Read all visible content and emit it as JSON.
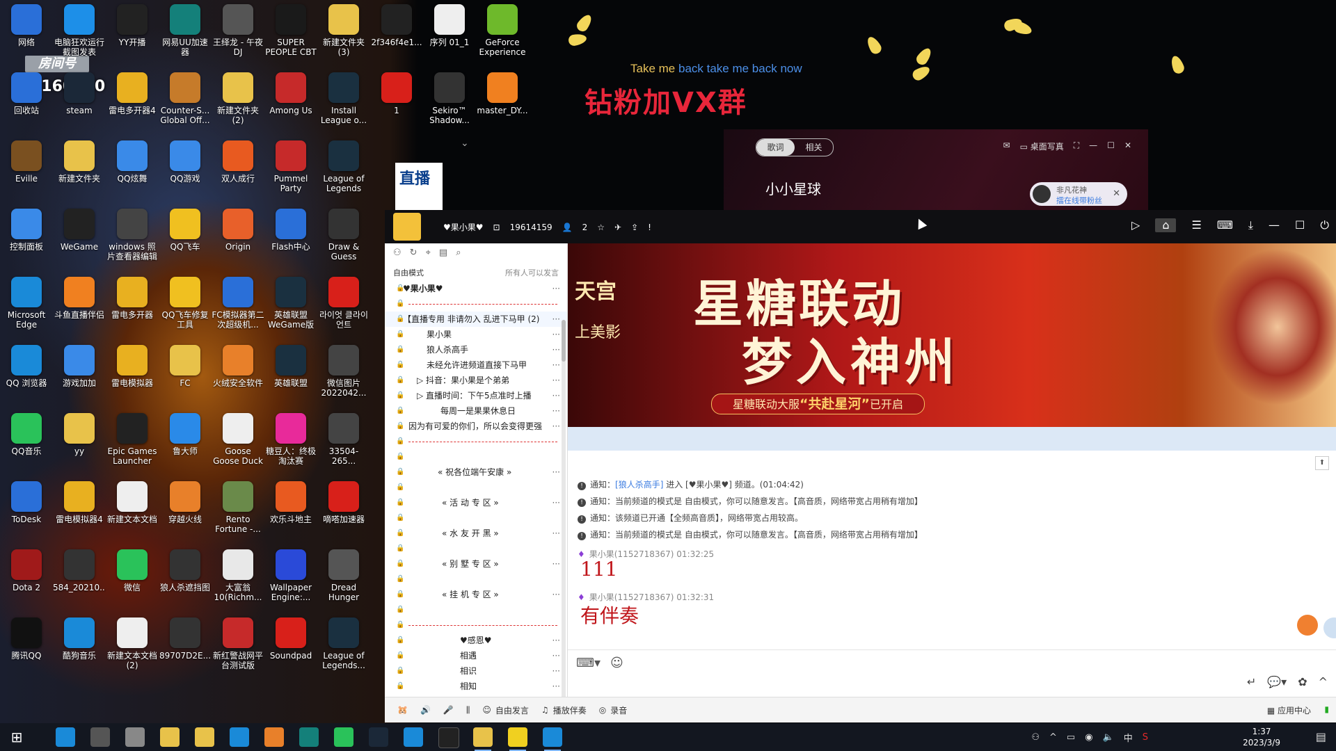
{
  "overlay": {
    "lyric_sung": "Take me ",
    "lyric_unsung": "back take me back now",
    "title": "钻粉加VX群",
    "room_label": "房间号",
    "room_number": "3160250"
  },
  "desktop_icons": [
    {
      "label": "网络",
      "icon": "network-icon",
      "color": "#2a6fd8"
    },
    {
      "label": "电脑狂欢运行截图发表",
      "icon": "win-icon",
      "color": "#1d8fe8"
    },
    {
      "label": "YY开播",
      "icon": "yy-live-icon",
      "color": "#222"
    },
    {
      "label": "网易UU加速器",
      "icon": "uu-icon",
      "color": "#14807a"
    },
    {
      "label": "王绎龙 - 午夜DJ",
      "icon": "media-thumb-icon",
      "color": "#555"
    },
    {
      "label": "SUPER PEOPLE CBT",
      "icon": "super-people-icon",
      "color": "#1a1a1a"
    },
    {
      "label": "新建文件夹 (3)",
      "icon": "folder-icon",
      "color": "#e8c24a"
    },
    {
      "label": "2f346f4e1...",
      "icon": "file-icon",
      "color": "#222"
    },
    {
      "label": "序列 01_1",
      "icon": "video-file-icon",
      "color": "#eee"
    },
    {
      "label": "GeForce Experience",
      "icon": "nvidia-icon",
      "color": "#6eb92b"
    },
    {
      "label": "回收站",
      "icon": "recycle-bin-icon",
      "color": "#2a6fd8"
    },
    {
      "label": "steam",
      "icon": "steam-icon",
      "color": "#1b2838"
    },
    {
      "label": "雷电多开器4",
      "icon": "ld-multi-icon",
      "color": "#e8b020"
    },
    {
      "label": "Counter-S... Global Off...",
      "icon": "csgo-icon",
      "color": "#c67b2a"
    },
    {
      "label": "新建文件夹 (2)",
      "icon": "folder-icon",
      "color": "#e8c24a"
    },
    {
      "label": "Among Us",
      "icon": "among-us-icon",
      "color": "#c62a2a"
    },
    {
      "label": "Install League o...",
      "icon": "lol-icon",
      "color": "#1a3040"
    },
    {
      "label": "1",
      "icon": "flag-icon",
      "color": "#d8201a"
    },
    {
      "label": "Sekiro™ Shadow...",
      "icon": "sekiro-icon",
      "color": "#333"
    },
    {
      "label": "master_DY...",
      "icon": "douyu-icon",
      "color": "#f08020"
    },
    {
      "label": "Eville",
      "icon": "eville-icon",
      "color": "#7a5020"
    },
    {
      "label": "新建文件夹",
      "icon": "folder-icon",
      "color": "#e8c24a"
    },
    {
      "label": "QQ炫舞",
      "icon": "qq-dance-icon",
      "color": "#3a8ae8"
    },
    {
      "label": "QQ游戏",
      "icon": "qq-game-icon",
      "color": "#3a8ae8"
    },
    {
      "label": "双人成行",
      "icon": "it-takes-two-icon",
      "color": "#e85a20"
    },
    {
      "label": "Pummel Party",
      "icon": "pummel-party-icon",
      "color": "#c62a2a"
    },
    {
      "label": "League of Legends",
      "icon": "lol-icon",
      "color": "#1a3040"
    },
    {
      "label": "控制面板",
      "icon": "control-panel-icon",
      "color": "#3a8ae8"
    },
    {
      "label": "WeGame",
      "icon": "wegame-icon",
      "color": "#222"
    },
    {
      "label": "windows 照片查看器编辑",
      "icon": "photo-viewer-icon",
      "color": "#444"
    },
    {
      "label": "QQ飞车",
      "icon": "qq-speed-icon",
      "color": "#f0c020"
    },
    {
      "label": "Origin",
      "icon": "origin-icon",
      "color": "#e8602a"
    },
    {
      "label": "Flash中心",
      "icon": "flash-icon",
      "color": "#2a6fd8"
    },
    {
      "label": "Draw & Guess",
      "icon": "draw-guess-icon",
      "color": "#333"
    },
    {
      "label": "Microsoft Edge",
      "icon": "edge-icon",
      "color": "#1a8ad8"
    },
    {
      "label": "斗鱼直播伴侣",
      "icon": "douyu-companion-icon",
      "color": "#f08020"
    },
    {
      "label": "雷电多开器",
      "icon": "ld-multi-icon",
      "color": "#e8b020"
    },
    {
      "label": "QQ飞车修复工具",
      "icon": "qq-speed-icon",
      "color": "#f0c020"
    },
    {
      "label": "FC模拟器第二次超级机...",
      "icon": "fc-emulator-icon",
      "color": "#2a6fd8"
    },
    {
      "label": "英雄联盟WeGame版",
      "icon": "lol-icon",
      "color": "#1a3040"
    },
    {
      "label": "라이엇 클라이언트",
      "icon": "riot-icon",
      "color": "#d8201a"
    },
    {
      "label": "QQ 浏览器",
      "icon": "qq-browser-icon",
      "color": "#1a8ad8"
    },
    {
      "label": "游戏加加",
      "icon": "game-plus-icon",
      "color": "#3a8ae8"
    },
    {
      "label": "雷电模拟器",
      "icon": "ld-player-icon",
      "color": "#e8b020"
    },
    {
      "label": "FC",
      "icon": "folder-icon",
      "color": "#e8c24a"
    },
    {
      "label": "火绒安全软件",
      "icon": "huorong-icon",
      "color": "#e8802a"
    },
    {
      "label": "英雄联盟",
      "icon": "lol-icon",
      "color": "#1a3040"
    },
    {
      "label": "微信图片 2022042...",
      "icon": "image-file-icon",
      "color": "#444"
    },
    {
      "label": "QQ音乐",
      "icon": "qq-music-icon",
      "color": "#2ac25a"
    },
    {
      "label": "yy",
      "icon": "yy-icon",
      "color": "#e8c24a"
    },
    {
      "label": "Epic Games Launcher",
      "icon": "epic-icon",
      "color": "#222"
    },
    {
      "label": "鲁大师",
      "icon": "ludashi-icon",
      "color": "#2a8ae8"
    },
    {
      "label": "Goose Goose Duck",
      "icon": "goose-icon",
      "color": "#eee"
    },
    {
      "label": "糖豆人：终极淘汰赛",
      "icon": "fall-guys-icon",
      "color": "#e82a9a"
    },
    {
      "label": "33504-265...",
      "icon": "image-file-icon",
      "color": "#444"
    },
    {
      "label": "ToDesk",
      "icon": "todesk-icon",
      "color": "#2a6fd8"
    },
    {
      "label": "雷电模拟器4",
      "icon": "ld-player-icon",
      "color": "#e8b020"
    },
    {
      "label": "新建文本文档",
      "icon": "text-file-icon",
      "color": "#eee"
    },
    {
      "label": "穿越火线",
      "icon": "crossfire-icon",
      "color": "#e8802a"
    },
    {
      "label": "Rento Fortune -...",
      "icon": "rento-icon",
      "color": "#6a8a4a"
    },
    {
      "label": "欢乐斗地主",
      "icon": "doudizhu-icon",
      "color": "#e85a20"
    },
    {
      "label": "嘀嗒加速器",
      "icon": "dida-icon",
      "color": "#d8201a"
    },
    {
      "label": "Dota 2",
      "icon": "dota2-icon",
      "color": "#a01a1a"
    },
    {
      "label": "584_20210...",
      "icon": "video-file-icon",
      "color": "#333"
    },
    {
      "label": "微信",
      "icon": "wechat-icon",
      "color": "#2ac25a"
    },
    {
      "label": "狼人杀遮挡图",
      "icon": "image-file-icon",
      "color": "#333"
    },
    {
      "label": "大富翁10(Richm...",
      "icon": "richman-icon",
      "color": "#e8e8e8"
    },
    {
      "label": "Wallpaper Engine:...",
      "icon": "wallpaper-engine-icon",
      "color": "#2a4ad8"
    },
    {
      "label": "Dread Hunger",
      "icon": "dread-hunger-icon",
      "color": "#555"
    },
    {
      "label": "腾讯QQ",
      "icon": "qq-icon",
      "color": "#111"
    },
    {
      "label": "酷狗音乐",
      "icon": "kugou-icon",
      "color": "#1a8ad8"
    },
    {
      "label": "新建文本文档 (2)",
      "icon": "text-file-icon",
      "color": "#eee"
    },
    {
      "label": "89707D2E...",
      "icon": "video-file-icon",
      "color": "#333"
    },
    {
      "label": "新红警战网平台测试版",
      "icon": "red-alert-icon",
      "color": "#c62a2a"
    },
    {
      "label": "Soundpad",
      "icon": "soundpad-icon",
      "color": "#d8201a"
    },
    {
      "label": "League of Legends...",
      "icon": "lol-icon",
      "color": "#1a3040"
    }
  ],
  "music_player": {
    "tab_lyrics": "歌词",
    "tab_related": "相关",
    "song_title": "小小星球",
    "desktop_photo": "桌面写真",
    "badge_name": "非凡花神",
    "badge_sub": "擂在线带粉丝",
    "streamer_tag": "直播"
  },
  "yy": {
    "room_name": "♥果小果♥",
    "room_id": "19614159",
    "viewers": "2",
    "mode_label": "自由模式",
    "mode_right": "所有人可以发言",
    "channels": [
      {
        "text": "♥果小果♥",
        "indent": 26,
        "bold": true
      },
      {
        "text": "",
        "dashed": true
      },
      {
        "text": "【直播专用  非请勿入  乱进下马甲",
        "indent": 26,
        "active": true,
        "suffix": "(2)"
      },
      {
        "text": "果小果",
        "indent": 60
      },
      {
        "text": "狼人杀高手",
        "indent": 60
      },
      {
        "text": "未经允许进频道直接下马甲",
        "indent": 60
      },
      {
        "text": "▷  抖音：果小果是个弟弟",
        "indent": 46
      },
      {
        "text": "▷  直播时间：下午5点准时上播",
        "indent": 46
      },
      {
        "text": "每周一是果果休息日",
        "indent": 80
      },
      {
        "text": "因为有可爱的你们，所以会变得更强",
        "indent": 34
      },
      {
        "text": "",
        "dashed": true
      },
      {
        "text": "",
        "dashed": false
      },
      {
        "text": "«  祝各位端午安康  »",
        "indent": 76
      },
      {
        "text": "",
        "dashed": false
      },
      {
        "text": "«  活 动 专 区  »",
        "indent": 82
      },
      {
        "text": "",
        "dashed": false
      },
      {
        "text": "«  水 友 开 黑  »",
        "indent": 82
      },
      {
        "text": "",
        "dashed": false
      },
      {
        "text": "«  别 墅 专 区  »",
        "indent": 82
      },
      {
        "text": "",
        "dashed": false
      },
      {
        "text": "«  挂 机 专 区  »",
        "indent": 82
      },
      {
        "text": "",
        "dashed": false
      },
      {
        "text": "",
        "dashed": true
      },
      {
        "text": "♥感恩♥",
        "indent": 108
      },
      {
        "text": "相遇",
        "indent": 108
      },
      {
        "text": "相识",
        "indent": 108
      },
      {
        "text": "相知",
        "indent": 108
      }
    ],
    "banner": {
      "brand": "天宫",
      "brand_sub": "上美影",
      "headline1": "星糖联动",
      "headline2": "梦入神州",
      "sub_pre": "星糖联动大服",
      "sub_hl": "“共赴星河”",
      "sub_post": "已开启"
    },
    "notices": [
      {
        "pre": "通知：",
        "hl": "[狼人杀高手]",
        "post": " 进入 [♥果小果♥] 频道。(01:04:42)"
      },
      {
        "pre": "通知：",
        "hl": "",
        "post": "当前频道的模式是 自由模式，你可以随意发言。【高音质，网络带宽占用稍有增加】"
      },
      {
        "pre": "通知：",
        "hl": "",
        "post": "该频道已开通【全频高音质】，网络带宽占用较高。"
      },
      {
        "pre": "通知：",
        "hl": "",
        "post": "当前频道的模式是 自由模式，你可以随意发言。【高音质，网络带宽占用稍有增加】"
      }
    ],
    "messages": [
      {
        "author": "果小果(1152718367)",
        "time": "01:32:25",
        "text": "111"
      },
      {
        "author": "果小果(1152718367)",
        "time": "01:32:31",
        "text": "有伴奏"
      }
    ],
    "bottom": {
      "free_speak": "自由发言",
      "play_accompaniment": "播放伴奏",
      "record": "录音",
      "app_center": "应用中心"
    }
  },
  "taskbar": {
    "time": "1:37",
    "date": "2023/3/9",
    "ime": "中"
  }
}
